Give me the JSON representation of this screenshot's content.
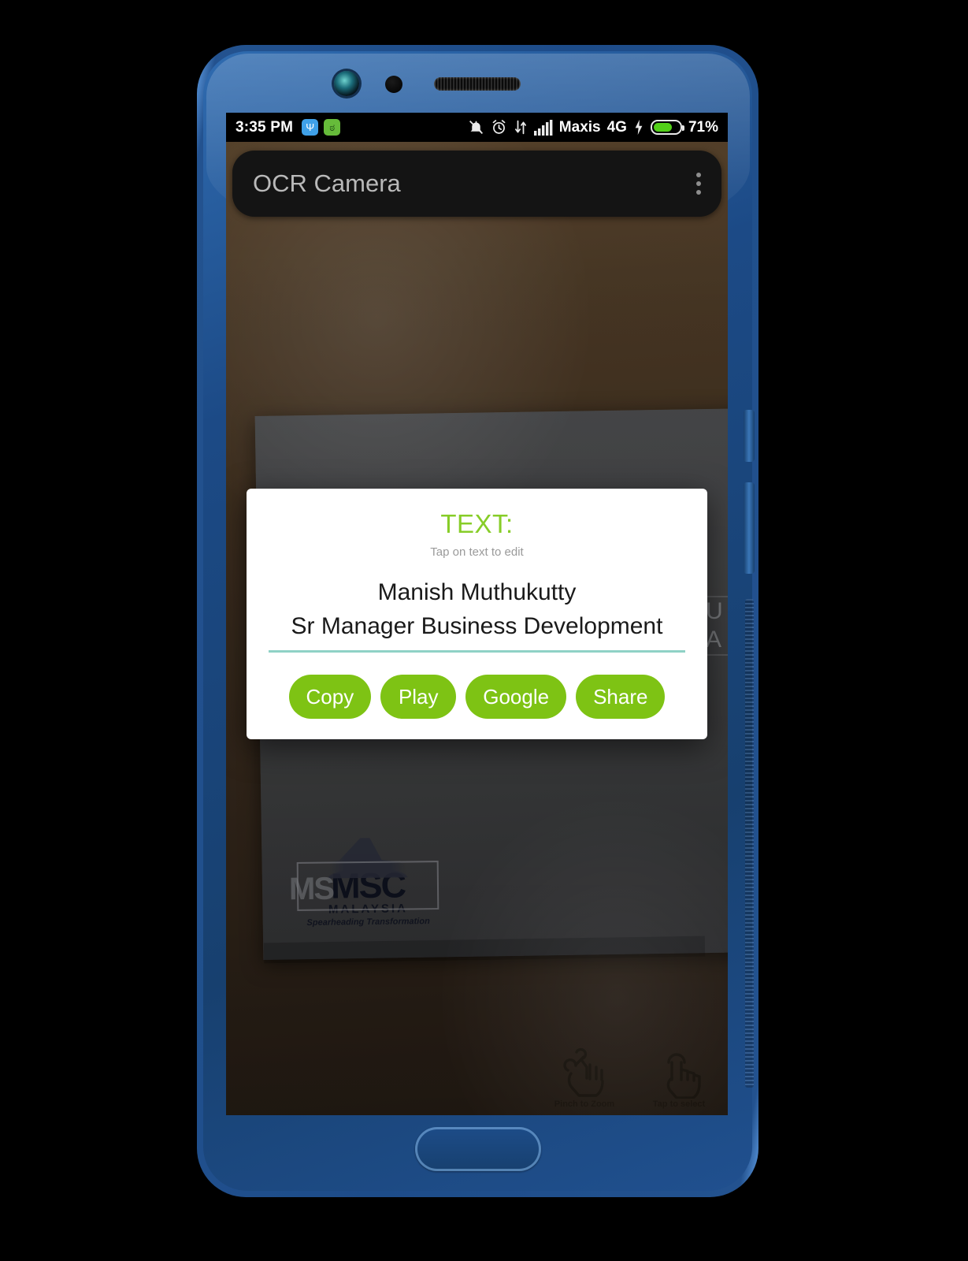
{
  "device": {
    "frame_color": "#1d4c89",
    "hardware": {
      "front_camera": "front-camera",
      "proximity_sensor": "proximity-sensor",
      "earpiece": "earpiece-speaker",
      "home_button": "home-button"
    }
  },
  "status_bar": {
    "time": "3:35 PM",
    "left_icons": [
      {
        "name": "usb-debug-icon",
        "glyph": "Ψ",
        "bg": "#3fa0e8"
      },
      {
        "name": "android-app-icon",
        "glyph": "ಠ",
        "bg": "#66bb3a"
      }
    ],
    "right_icons": [
      "notifications-muted-icon",
      "alarm-icon",
      "data-transfer-icon",
      "signal-bars-icon",
      "charging-bolt-icon",
      "battery-icon"
    ],
    "carrier": "Maxis",
    "network": "4G",
    "battery_percent": "71%",
    "battery_level": 71,
    "battery_color": "#52d018"
  },
  "appbar": {
    "title": "OCR Camera",
    "overflow_menu": "overflow-menu"
  },
  "camera_preview": {
    "scene": "business card on wooden table",
    "card": {
      "logo_word": "MSC",
      "logo_sub": "MALAYSIA",
      "logo_tagline": "Spearheading Transformation",
      "detected_fragment": "MS"
    },
    "background_text_fragment": "U\nA",
    "hints": [
      {
        "icon": "pinch-zoom-gesture-icon",
        "label": "Pinch to Zoom"
      },
      {
        "icon": "tap-select-gesture-icon",
        "label": "Tap to select"
      }
    ]
  },
  "dialog": {
    "title": "TEXT:",
    "title_color": "#87cd28",
    "subtitle": "Tap on text to edit",
    "recognized_lines": [
      "Manish Muthukutty",
      "Sr Manager Business Development"
    ],
    "underline_color": "#8fd2c6",
    "buttons": [
      {
        "label": "Copy",
        "name": "copy-button"
      },
      {
        "label": "Play",
        "name": "play-button"
      },
      {
        "label": "Google",
        "name": "google-button"
      },
      {
        "label": "Share",
        "name": "share-button"
      }
    ],
    "button_color": "#7ec314"
  }
}
